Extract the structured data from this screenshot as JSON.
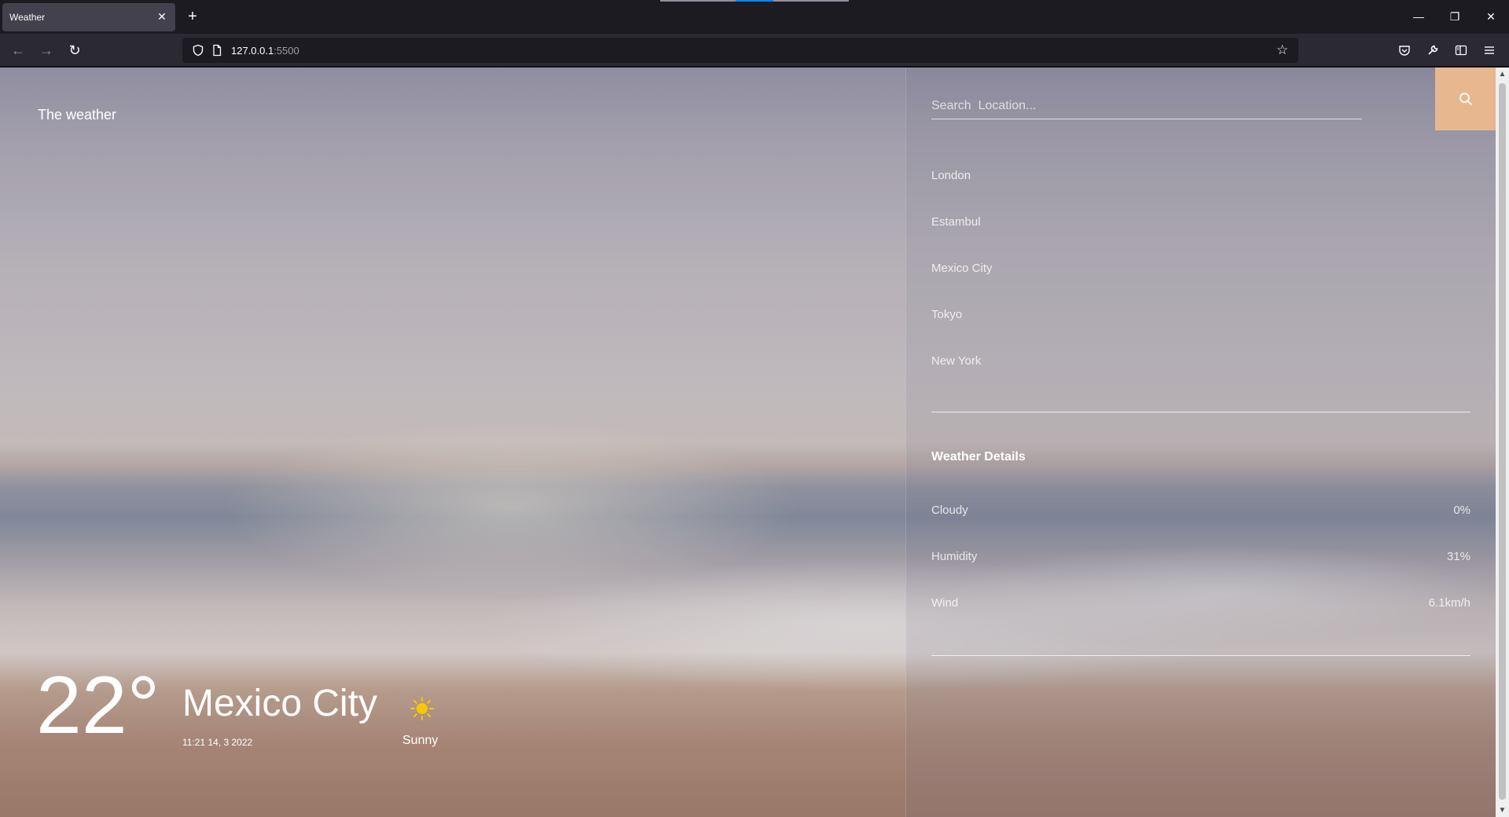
{
  "browser": {
    "tab_title": "Weather",
    "tab_close": "✕",
    "new_tab": "+",
    "url_host": "127.0.0.1",
    "url_port": ":5500",
    "window": {
      "minimize": "—",
      "restore": "❐",
      "close": "✕"
    }
  },
  "app": {
    "brand": "The weather",
    "current": {
      "temperature": "22°",
      "city": "Mexico City",
      "datetime": "11:21 14, 3 2022",
      "condition": "Sunny",
      "condition_icon": "sun-icon"
    },
    "search": {
      "placeholder": "Search  Location...",
      "value": ""
    },
    "locations": [
      "London",
      "Estambul",
      "Mexico City",
      "Tokyo",
      "New York"
    ],
    "details": {
      "title": "Weather Details",
      "rows": [
        {
          "label": "Cloudy",
          "value": "0%"
        },
        {
          "label": "Humidity",
          "value": "31%"
        },
        {
          "label": "Wind",
          "value": "6.1km/h"
        }
      ]
    },
    "colors": {
      "accent": "#e7b88f",
      "sun": "#f7c800"
    }
  }
}
